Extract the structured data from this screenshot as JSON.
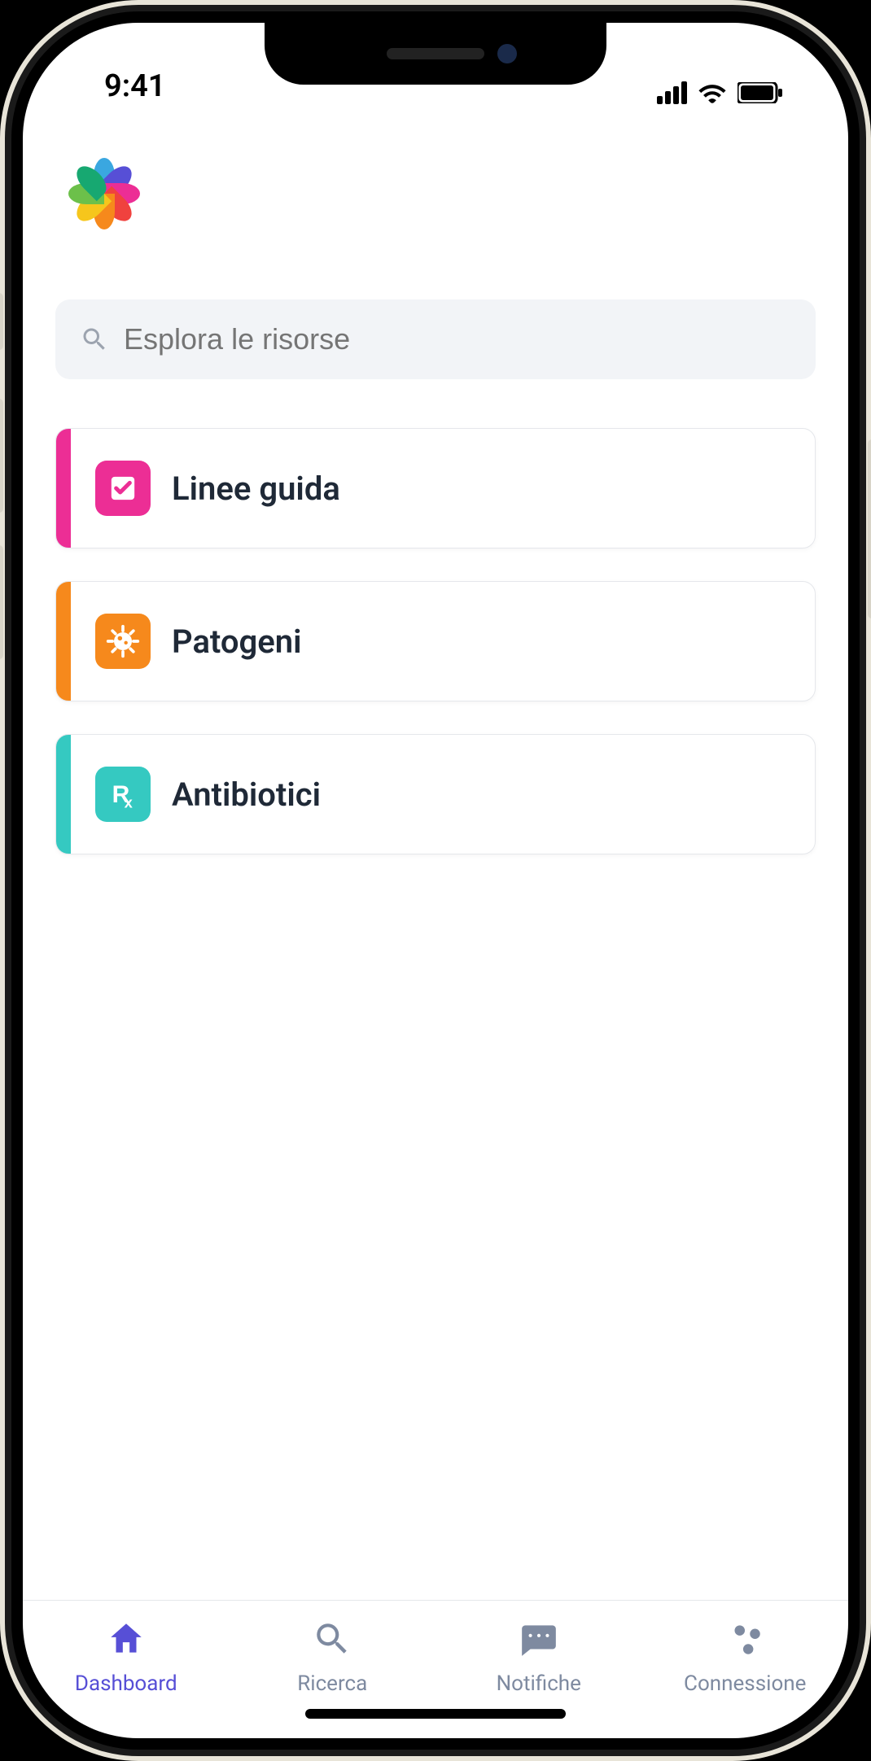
{
  "status": {
    "time": "9:41"
  },
  "search": {
    "placeholder": "Esplora le risorse"
  },
  "categories": [
    {
      "label": "Linee guida",
      "color": "#ec2e95",
      "icon": "check"
    },
    {
      "label": "Patogeni",
      "color": "#f6891c",
      "icon": "virus"
    },
    {
      "label": "Antibiotici",
      "color": "#35c9c1",
      "icon": "rx"
    }
  ],
  "tabs": [
    {
      "label": "Dashboard",
      "icon": "home",
      "active": true
    },
    {
      "label": "Ricerca",
      "icon": "search",
      "active": false
    },
    {
      "label": "Notifiche",
      "icon": "message",
      "active": false
    },
    {
      "label": "Connessione",
      "icon": "network",
      "active": false
    }
  ],
  "logo_colors": [
    "#3aa7e0",
    "#574fd6",
    "#ec2e95",
    "#f0423e",
    "#f6891c",
    "#f6c61c",
    "#6cc04a",
    "#17a871"
  ]
}
